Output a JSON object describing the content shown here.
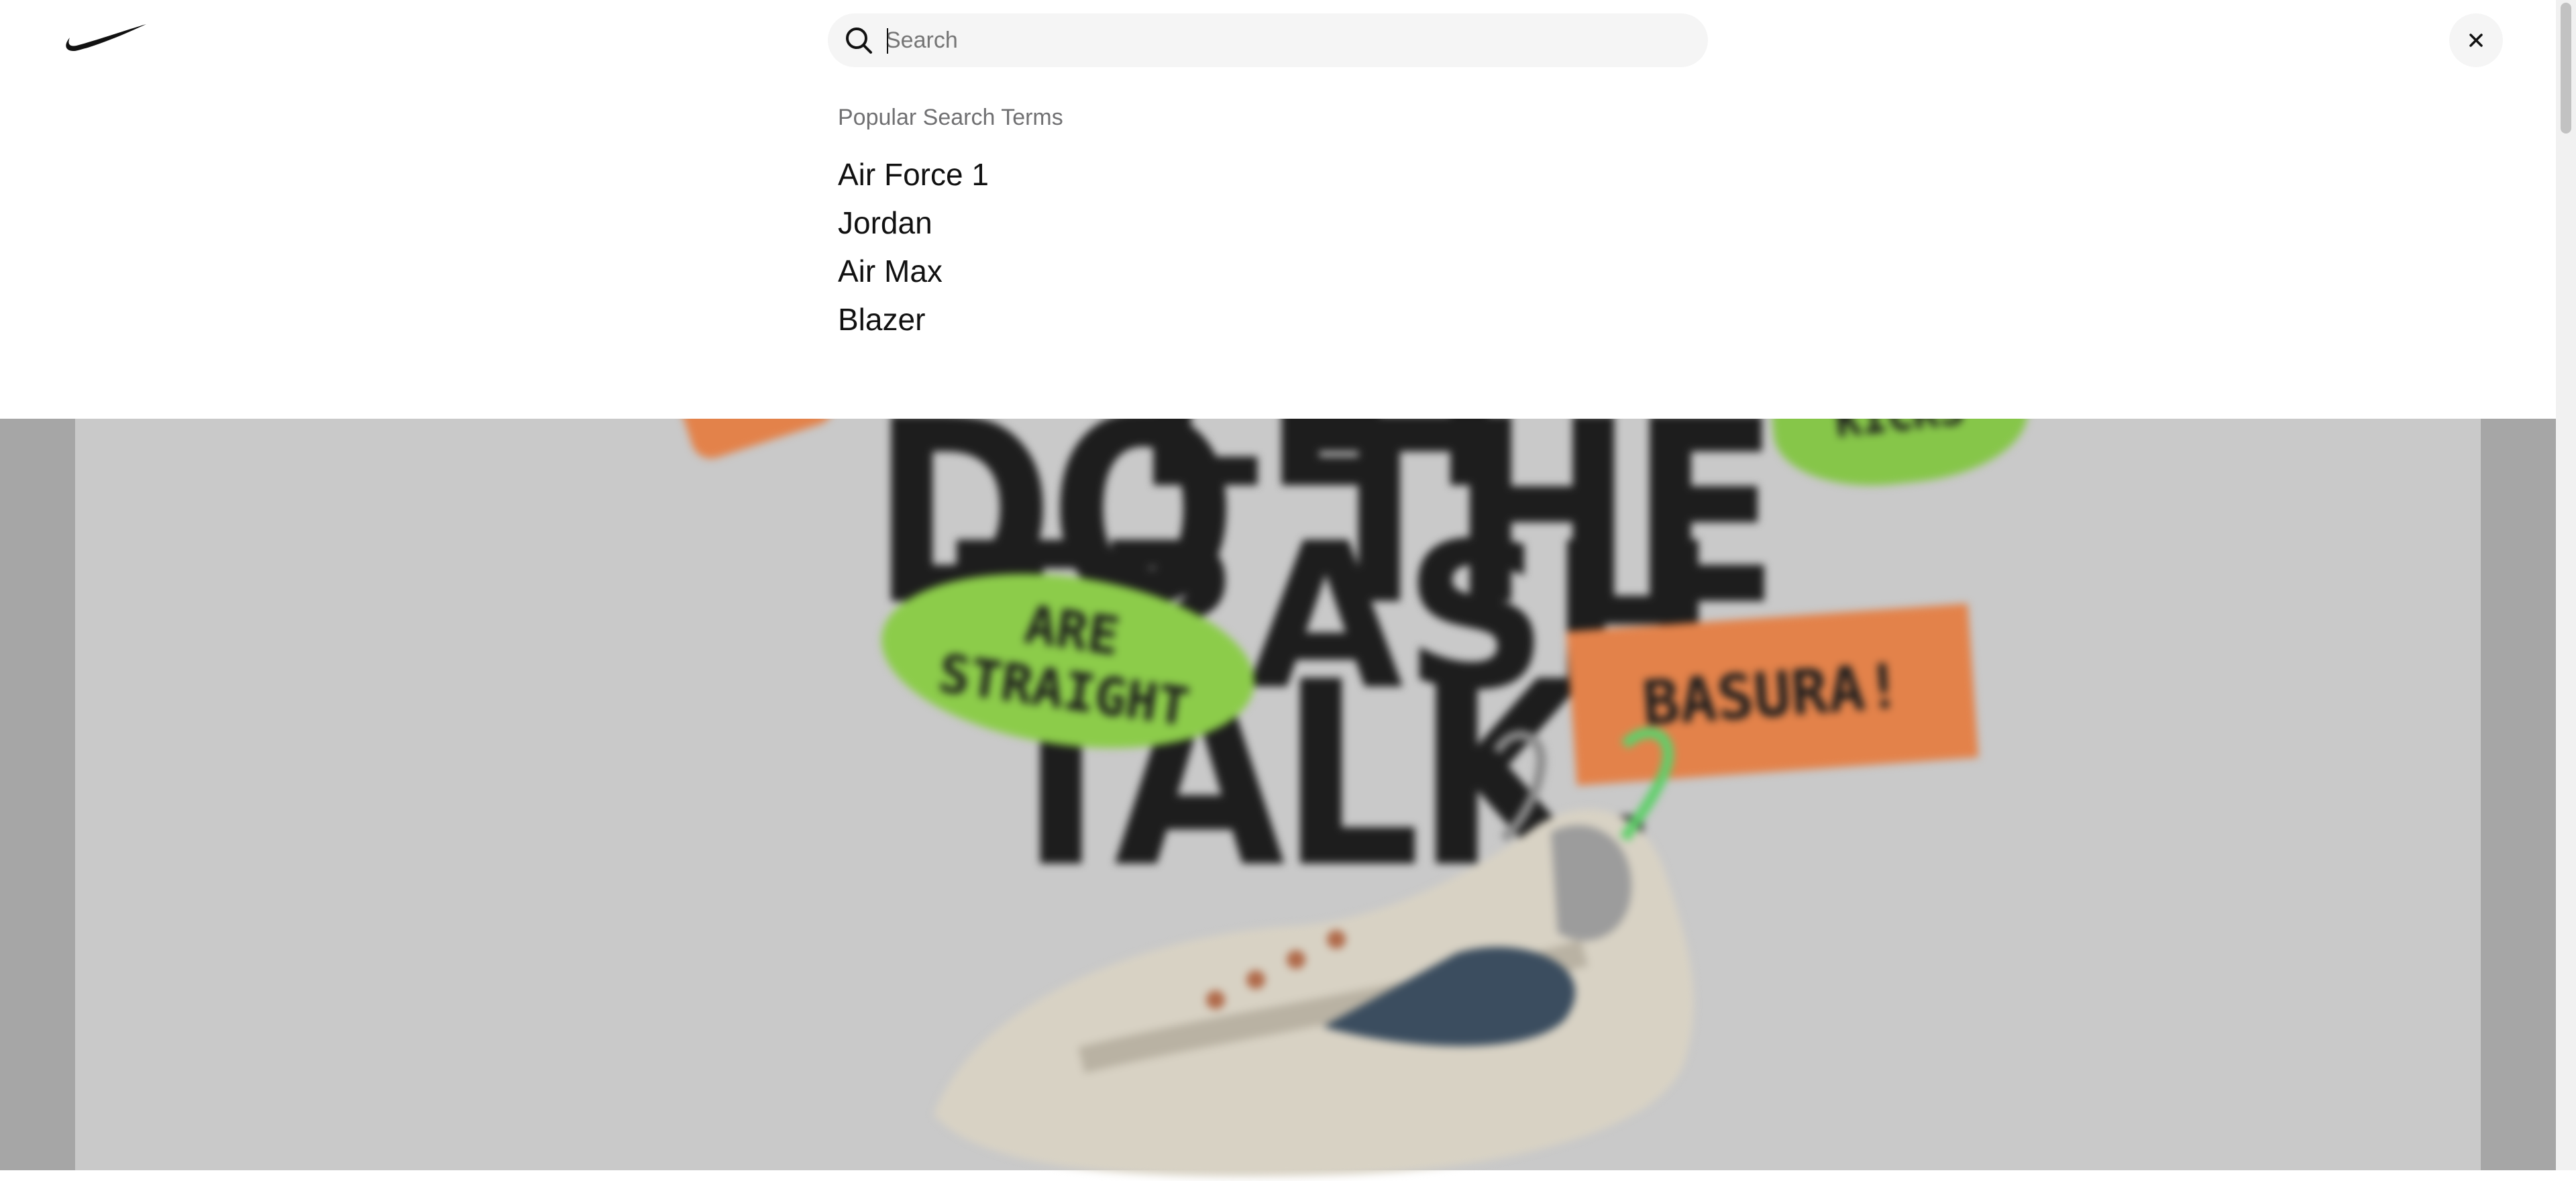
{
  "header": {
    "logo_name": "nike-swoosh-logo",
    "search": {
      "placeholder": "Search",
      "value": ""
    },
    "close_icon": "close-icon"
  },
  "popular_search": {
    "heading": "Popular Search Terms",
    "terms": [
      {
        "label": "Air Force 1"
      },
      {
        "label": "Jordan"
      },
      {
        "label": "Air Max"
      },
      {
        "label": "Blazer"
      }
    ]
  },
  "hero": {
    "headline_top": "LET TRASH",
    "headline": "DO THE TALK.",
    "bubble_left": "ARE STRAIGHT",
    "bubble_right": "BASURA!",
    "bubble_top": "KICKS"
  },
  "colors": {
    "overlay_bg": "#ffffff",
    "search_bg": "#f5f5f5",
    "text_primary": "#111111",
    "text_secondary": "#707072",
    "backdrop": "#a6a6a6"
  }
}
